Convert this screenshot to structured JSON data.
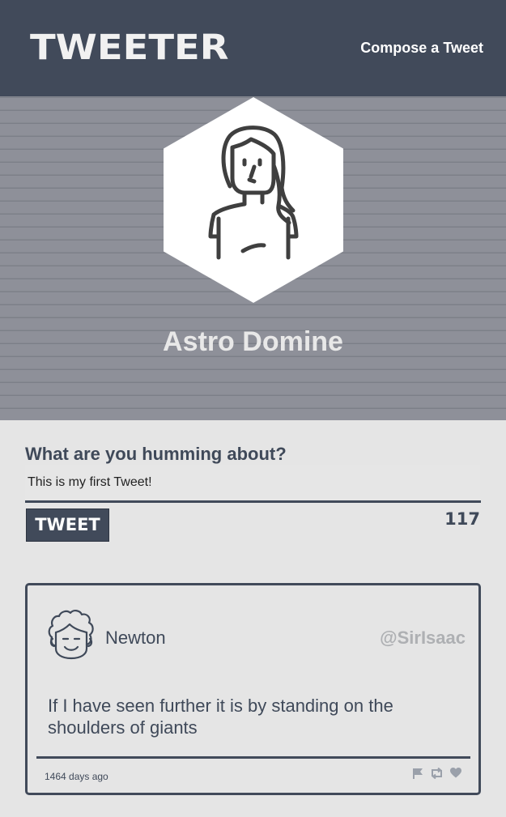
{
  "nav": {
    "brand": "TWEETER",
    "compose_link": "Compose a Tweet"
  },
  "profile": {
    "name": "Astro Domine"
  },
  "compose": {
    "prompt": "What are you humming about?",
    "input_value": "This is my first Tweet!",
    "button_label": "TWEET",
    "counter": "117"
  },
  "tweets": [
    {
      "author": "Newton",
      "handle": "@SirIsaac",
      "text": "If I have seen further it is by standing on the shoulders of giants",
      "time": "1464 days ago",
      "icons": [
        "flag-icon",
        "retweet-icon",
        "heart-icon"
      ]
    }
  ],
  "colors": {
    "nav_bg": "#414a5a",
    "page_bg": "#e5e5e5",
    "accent": "#3f4959",
    "handle_grey": "#aeb0b3"
  }
}
